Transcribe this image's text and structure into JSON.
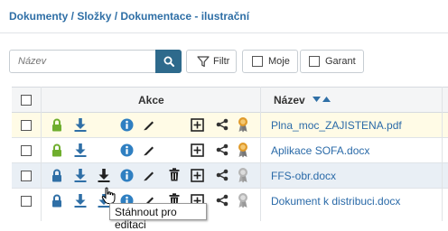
{
  "breadcrumb": "Dokumenty / Složky / Dokumentace - ilustrační",
  "search": {
    "placeholder": "Název",
    "value": ""
  },
  "toolbar": {
    "filter_label": "Filtr",
    "mine_label": "Moje",
    "guarantor_label": "Garant",
    "mine_checked": false,
    "guarantor_checked": false
  },
  "table": {
    "columns": [
      "Akce",
      "Název"
    ],
    "sort": "ascending",
    "rows": [
      {
        "name": "Plna_moc_ZAJISTENA.pdf",
        "locked": true
      },
      {
        "name": "Aplikace SOFA.docx",
        "locked": true
      },
      {
        "name": "FFS-obr.docx",
        "locked": false
      },
      {
        "name": "Dokument k distribuci.docx",
        "locked": false
      }
    ]
  },
  "tooltip": "Stáhnout pro editaci",
  "colors": {
    "link": "#2a6aa8",
    "accent": "#2e6a8c",
    "lock_green": "#6fae2e",
    "lock_blue": "#2f6fa6",
    "info": "#2f7fc1",
    "row_highlight": "#fffbe6"
  }
}
